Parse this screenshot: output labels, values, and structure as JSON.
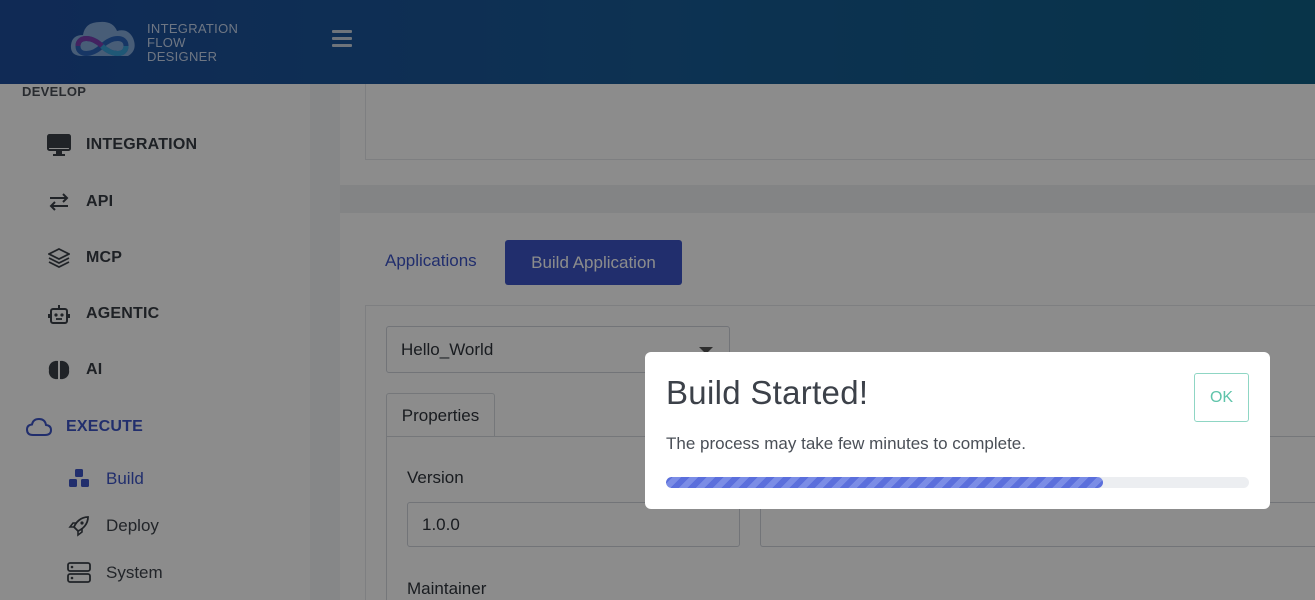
{
  "header": {
    "logo_lines": [
      "INTEGRATION",
      "FLOW",
      "DESIGNER"
    ]
  },
  "sidebar": {
    "develop_label": "DEVELOP",
    "items": [
      {
        "label": "INTEGRATION",
        "icon": "monitor-icon"
      },
      {
        "label": "API",
        "icon": "swap-arrows-icon"
      },
      {
        "label": "MCP",
        "icon": "layers-icon"
      },
      {
        "label": "AGENTIC",
        "icon": "robot-icon"
      },
      {
        "label": "AI",
        "icon": "brain-icon"
      }
    ],
    "execute": {
      "label": "EXECUTE",
      "icon": "cloud-icon"
    },
    "sub_items": [
      {
        "label": "Build",
        "icon": "cubes-icon",
        "active": true
      },
      {
        "label": "Deploy",
        "icon": "rocket-icon"
      },
      {
        "label": "System",
        "icon": "server-icon"
      }
    ]
  },
  "main": {
    "tabs": [
      {
        "label": "Applications"
      },
      {
        "label": "Build Application",
        "active": true
      }
    ],
    "app_select": {
      "value": "Hello_World"
    },
    "sub_tab": "Properties",
    "fields": {
      "version_label": "Version",
      "version_value": "1.0.0",
      "maintainer_label": "Maintainer"
    }
  },
  "modal": {
    "title": "Build Started!",
    "message": "The process may take few minutes to complete.",
    "ok_label": "OK",
    "progress_percent": 75
  },
  "colors": {
    "accent": "#3d55c6",
    "header_start": "#1e4d9c",
    "header_end": "#0f5f85",
    "ok_button": "#5fc4aa",
    "progress": "#5b6fdc"
  }
}
